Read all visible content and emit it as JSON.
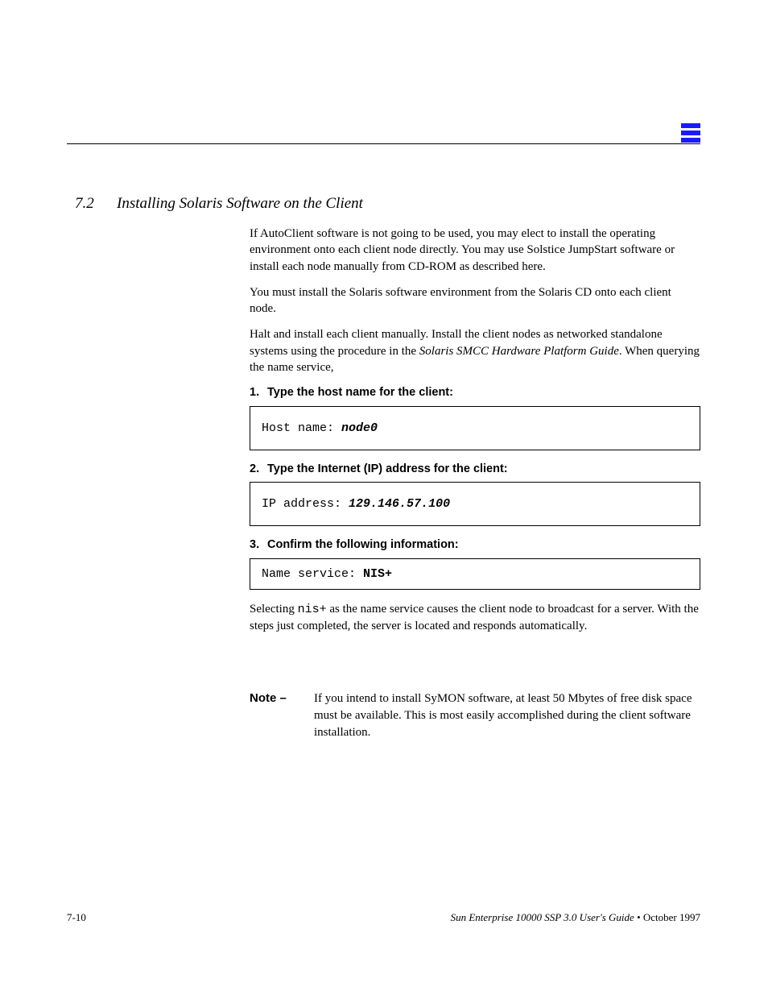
{
  "section": {
    "number": "7.2",
    "title": "Installing Solaris Software on the Client"
  },
  "content": {
    "p1": "If AutoClient software is not going to be used, you may elect to install the operating environment onto each client node directly. You may use Solstice JumpStart software or install each node manually from CD-ROM as described here.",
    "p2": "You must install the Solaris software environment from the Solaris CD onto each client node.",
    "p3_prefix": "Halt and install each client manually. Install the client nodes as networked standalone systems using the procedure in the ",
    "p3_italic": "Solaris SMCC Hardware Platform Guide",
    "p3_suffix": ". When querying the name service,",
    "step1": {
      "n": "1.",
      "text": "Type the host name for the client:"
    },
    "code1_label": "Host name:",
    "code1_value": "node0",
    "step2": {
      "n": "2.",
      "text": "Type the Internet (IP) address for the client:"
    },
    "code2_label": "IP address:",
    "code2_value": "129.146.57.100",
    "step3": {
      "n": "3.",
      "text": "Confirm the following information:"
    },
    "code3_prefix": "Name service: ",
    "code3_value": "NIS+",
    "p4_prefix": "Selecting ",
    "p4_code": "nis+",
    "p4_suffix": " as the name service causes the client node to broadcast for a server. With the steps just completed, the server is located and responds automatically.",
    "note": {
      "label": "Note –",
      "text": "If you intend to install SyMON software, at least 50 Mbytes of free disk space must be available. This is most easily accomplished during the client software installation."
    }
  },
  "footer": {
    "left": "7-10",
    "right_italic": "Sun Enterprise 10000 SSP 3.0 User's Guide",
    "right_plain": " • October 1997"
  }
}
